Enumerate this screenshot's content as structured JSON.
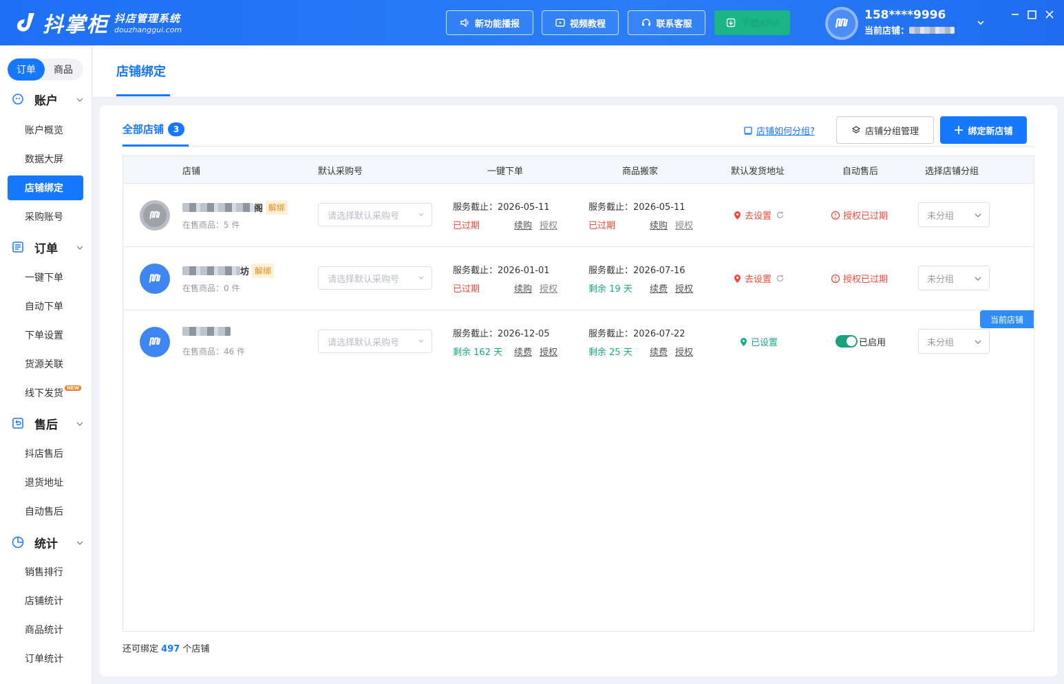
{
  "app": {
    "logo_text": "抖掌柜",
    "logo_sub": "抖店管理系统",
    "logo_domain": "douzhanggui.com"
  },
  "topbar": {
    "buttons": [
      {
        "label": "新功能播报",
        "icon": "speaker-icon"
      },
      {
        "label": "视频教程",
        "icon": "video-icon"
      },
      {
        "label": "联系客服",
        "icon": "headset-icon"
      },
      {
        "label": "下载APP",
        "icon": "download-icon"
      }
    ],
    "user_phone": "158****9996",
    "current_store_label": "当前店铺："
  },
  "sidebar": {
    "segments": [
      "订单",
      "商品"
    ],
    "groups": [
      {
        "label": "账户",
        "icon": "account-icon",
        "items": [
          "账户概览",
          "数据大屏",
          "店铺绑定",
          "采购账号"
        ]
      },
      {
        "label": "订单",
        "icon": "order-icon",
        "items": [
          "一键下单",
          "自动下单",
          "下单设置",
          "货源关联",
          "线下发货"
        ]
      },
      {
        "label": "售后",
        "icon": "aftersale-icon",
        "items": [
          "抖店售后",
          "退货地址",
          "自动售后"
        ]
      },
      {
        "label": "统计",
        "icon": "chart-pie-icon",
        "items": [
          "销售排行",
          "店铺统计",
          "商品统计",
          "订单统计"
        ]
      }
    ],
    "active_item": "店铺绑定",
    "new_badge": "NEW"
  },
  "page": {
    "title": "店铺绑定",
    "tab_label": "全部店铺",
    "tab_count": "3",
    "help_link": "店铺如何分组?",
    "group_manage_btn": "店铺分组管理",
    "bind_btn": "绑定新店铺",
    "footer_prefix": "还可绑定",
    "footer_count": "497",
    "footer_suffix": "个店铺"
  },
  "table": {
    "headers": [
      "店铺",
      "默认采购号",
      "一键下单",
      "商品搬家",
      "默认发货地址",
      "自动售后",
      "选择店铺分组"
    ],
    "select_placeholder": "请选择默认采购号",
    "group_placeholder": "未分组",
    "current_store_tag": "当前店铺",
    "rows": [
      {
        "name_suffix": "阁",
        "unbind": "解绑",
        "count": "在售商品：5 件",
        "order_deadline": "服务截止：2026-05-11",
        "order_status": "已过期",
        "order_links": [
          "续购",
          "授权"
        ],
        "move_deadline": "服务截止：2026-05-11",
        "move_status": "已过期",
        "move_links": [
          "续购",
          "授权"
        ],
        "address": "去设置",
        "after_sale": "授权已过期",
        "avatar_color": "#b9bcc2"
      },
      {
        "name_suffix": "坊",
        "unbind": "解绑",
        "count": "在售商品：0 件",
        "order_deadline": "服务截止：2026-01-01",
        "order_status": "已过期",
        "order_links": [
          "续购",
          "授权"
        ],
        "move_deadline": "服务截止：2026-07-16",
        "move_status": "剩余 19 天",
        "move_links": [
          "续费",
          "授权"
        ],
        "address": "去设置",
        "after_sale": "授权已过期",
        "avatar_color": "#3d86f3"
      },
      {
        "name_suffix": "",
        "unbind": "",
        "count": "在售商品：46 件",
        "order_deadline": "服务截止：2026-12-05",
        "order_status": "剩余 162 天",
        "order_links": [
          "续费",
          "授权"
        ],
        "move_deadline": "服务截止：2026-07-22",
        "move_status": "剩余 25 天",
        "move_links": [
          "续费",
          "授权"
        ],
        "address": "已设置",
        "after_sale": "已启用",
        "avatar_color": "#3d86f3"
      }
    ]
  },
  "colors": {
    "primary": "#1677ff",
    "danger": "#f5483b",
    "success": "#18a983",
    "download": "#19b585"
  }
}
